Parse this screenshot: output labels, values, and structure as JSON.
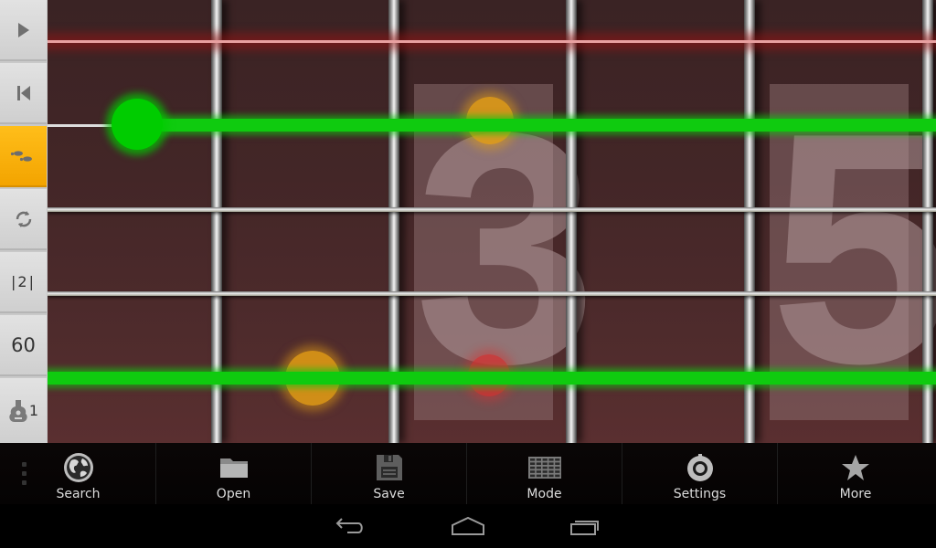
{
  "sidebar": {
    "items": [
      {
        "name": "play",
        "icon": "play-icon",
        "active": false
      },
      {
        "name": "rewind",
        "icon": "skip-to-start-icon",
        "active": false
      },
      {
        "name": "step-mode",
        "icon": "footprints-icon",
        "active": true
      },
      {
        "name": "loop",
        "icon": "loop-icon",
        "active": false
      },
      {
        "name": "repeat-count",
        "label": "|2|",
        "active": false
      },
      {
        "name": "tempo",
        "label": "60",
        "active": false
      },
      {
        "name": "instrument",
        "icon": "guitar-icon",
        "label": "1",
        "active": false
      }
    ],
    "active_color": "#f5a800"
  },
  "fretboard": {
    "fret_markers": [
      "3",
      "5"
    ],
    "highlight_color": "#0fcb0f",
    "selected_string_color": "#c03030"
  },
  "toolbar": {
    "items": [
      {
        "label": "Search",
        "icon": "globe-icon"
      },
      {
        "label": "Open",
        "icon": "folder-icon"
      },
      {
        "label": "Save",
        "icon": "floppy-disk-icon"
      },
      {
        "label": "Mode",
        "icon": "grid-icon"
      },
      {
        "label": "Settings",
        "icon": "gear-icon"
      },
      {
        "label": "More",
        "icon": "star-icon"
      }
    ]
  },
  "navbar": {
    "items": [
      "back-icon",
      "home-icon",
      "recent-apps-icon"
    ]
  }
}
